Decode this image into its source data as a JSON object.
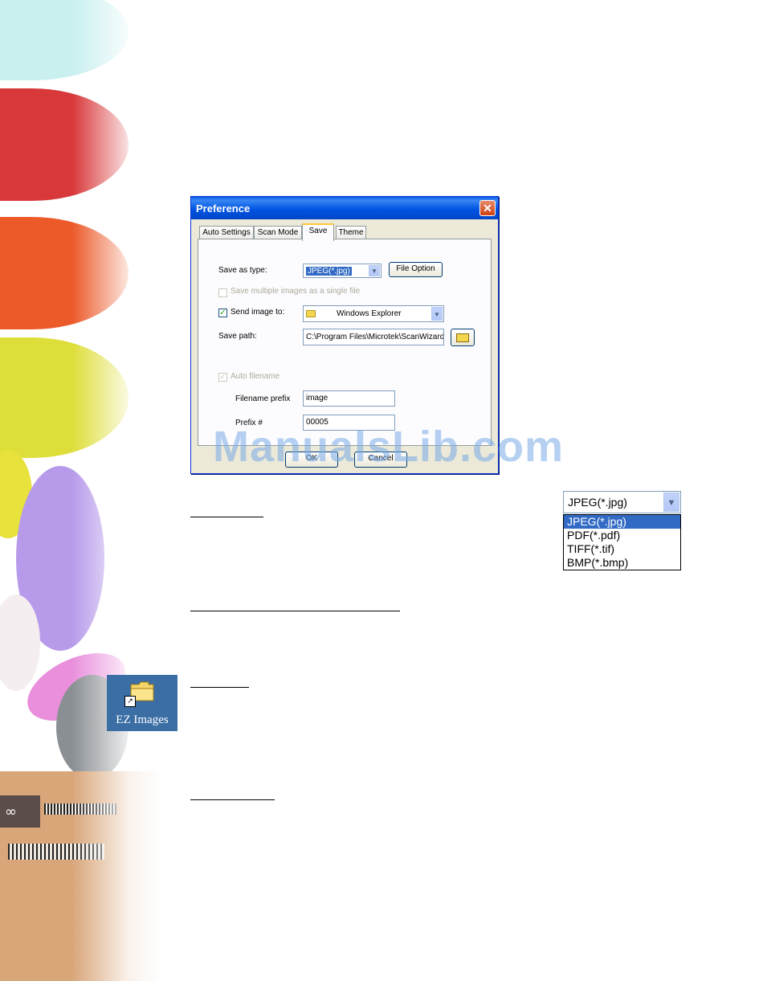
{
  "dialog": {
    "title": "Preference",
    "close_glyph": "✕",
    "tabs": [
      {
        "label": "Auto Settings"
      },
      {
        "label": "Scan Mode"
      },
      {
        "label": "Save"
      },
      {
        "label": "Theme"
      }
    ],
    "active_tab": "Save",
    "save_as_type": {
      "label": "Save as type:",
      "value": "JPEG(*.jpg)"
    },
    "file_option_button": "File Option",
    "save_multiple": {
      "label": "Save multiple images as a single file",
      "checked": false,
      "enabled": false
    },
    "send_image": {
      "label": "Send image to:",
      "checked": true,
      "value": "Windows Explorer"
    },
    "save_path": {
      "label": "Save path:",
      "value": "C:\\Program Files\\Microtek\\ScanWizard"
    },
    "auto_filename": {
      "label": "Auto filename",
      "checked": true,
      "enabled": false
    },
    "filename_prefix": {
      "label": "Filename prefix",
      "value": "image"
    },
    "prefix_number": {
      "label": "Prefix #",
      "value": "00005"
    },
    "ok_button": "OK",
    "cancel_button": "Cancel"
  },
  "type_dropdown": {
    "selected": "JPEG(*.jpg)",
    "options": [
      "JPEG(*.jpg)",
      "PDF(*.pdf)",
      "TIFF(*.tif)",
      "BMP(*.bmp)"
    ]
  },
  "desktop_icon": {
    "label": "EZ Images",
    "icon": "folder-shortcut-icon"
  },
  "watermark": "ManualsLib.com",
  "colors": {
    "title_bar": "#0054e3",
    "selection": "#316ac5",
    "dialog_bg": "#ece9d8"
  }
}
